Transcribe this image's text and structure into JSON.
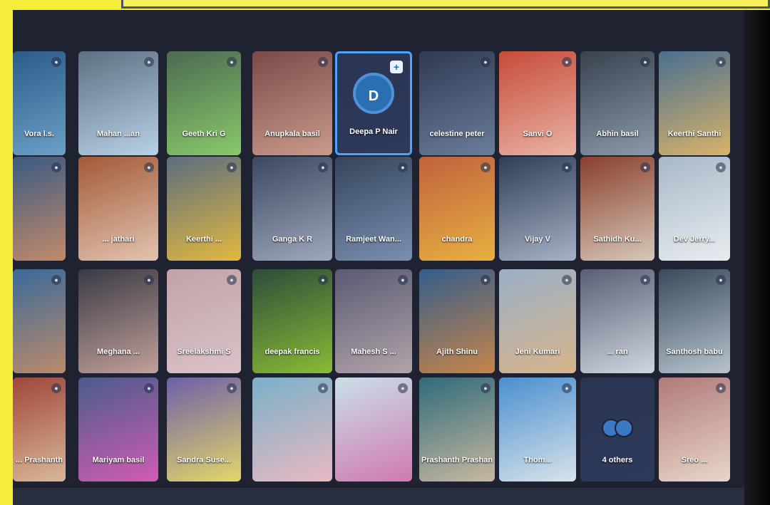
{
  "tiles": [
    {
      "name": "Vora l.s.",
      "bg": [
        "#2c5b88",
        "#6ca0c8"
      ]
    },
    {
      "name": "Mahan ...an",
      "bg": [
        "#5e6f83",
        "#b8d1e7"
      ]
    },
    {
      "name": "Geeth Kri G",
      "bg": [
        "#4c6a52",
        "#89c96a"
      ]
    },
    {
      "name": "Anupkala basil",
      "bg": [
        "#7a4a4a",
        "#c99b8a"
      ]
    },
    {
      "name": "Deepa P Nair",
      "bg": [
        "#2a3552",
        "#2d3a5a"
      ]
    },
    {
      "name": "celestine peter",
      "bg": [
        "#2f3a54",
        "#6b7d99"
      ]
    },
    {
      "name": "Sanvi O",
      "bg": [
        "#c74b3a",
        "#e9b3a4"
      ]
    },
    {
      "name": "Abhin basil",
      "bg": [
        "#39424f",
        "#8a99a9"
      ]
    },
    {
      "name": "Keerthi Santhi",
      "bg": [
        "#4a6f8f",
        "#d8b36a"
      ]
    },
    {
      "name": "",
      "bg": [
        "#3a5a82",
        "#c28a6a"
      ]
    },
    {
      "name": "... jathari",
      "bg": [
        "#a35a38",
        "#e2c4b0"
      ]
    },
    {
      "name": "Keerthi ...",
      "bg": [
        "#5b6d80",
        "#e2b840"
      ]
    },
    {
      "name": "Ganga K R",
      "bg": [
        "#3b4860",
        "#9ea8bd"
      ]
    },
    {
      "name": "Ramjeet Wan...",
      "bg": [
        "#35445b",
        "#7a8fb0"
      ]
    },
    {
      "name": "chandra",
      "bg": [
        "#c0623e",
        "#e8b040"
      ]
    },
    {
      "name": "Vijay V",
      "bg": [
        "#2f3e58",
        "#a6b2c6"
      ]
    },
    {
      "name": "Sathidh Ku...",
      "bg": [
        "#8a3f2e",
        "#d7c8b8"
      ]
    },
    {
      "name": "Dev Jerry...",
      "bg": [
        "#a8b8c8",
        "#e8ecef"
      ]
    },
    {
      "name": "",
      "bg": [
        "#3a6a9a",
        "#bb8a6a"
      ]
    },
    {
      "name": "Meghana ...",
      "bg": [
        "#3a3a45",
        "#c1a09a"
      ]
    },
    {
      "name": "Sreelakshmi S",
      "bg": [
        "#c2a2a8",
        "#d9c3c8"
      ]
    },
    {
      "name": "deepak francis",
      "bg": [
        "#2d4c3a",
        "#8abb35"
      ]
    },
    {
      "name": "Mahesh S ...",
      "bg": [
        "#5a5a73",
        "#b1a3a9"
      ]
    },
    {
      "name": "Ajith Shinu",
      "bg": [
        "#355d8a",
        "#c5854a"
      ]
    },
    {
      "name": "Jeni Kumari",
      "bg": [
        "#9ab0c8",
        "#d7b48a"
      ]
    },
    {
      "name": "... ran",
      "bg": [
        "#5a5e73",
        "#cfd6e0"
      ]
    },
    {
      "name": "Santhosh babu",
      "bg": [
        "#3a4a5a",
        "#b7c4d0"
      ]
    },
    {
      "name": "... Prashanth",
      "bg": [
        "#a0463a",
        "#d9b89a"
      ]
    },
    {
      "name": "Mariyam basil",
      "bg": [
        "#4a5c8a",
        "#d05cb3"
      ]
    },
    {
      "name": "Sandra Suse...",
      "bg": [
        "#6d5fa8",
        "#e3d66a"
      ]
    },
    {
      "name": "",
      "bg": [
        "#7ab0c8",
        "#e8b9c2"
      ]
    },
    {
      "name": "",
      "bg": [
        "#c9dfe8",
        "#d07ab0"
      ]
    },
    {
      "name": "Prashanth Prashan",
      "bg": [
        "#2f6b7a",
        "#c8b8a0"
      ]
    },
    {
      "name": "Thom...",
      "bg": [
        "#4a8fd0",
        "#d8e3ea"
      ]
    },
    {
      "name": "",
      "bg": [
        "#2a3552",
        "#2d3a5a"
      ]
    },
    {
      "name": "Sreo ...",
      "bg": [
        "#b07a7a",
        "#e8d6c8"
      ]
    }
  ],
  "active_tile": {
    "initial": "D",
    "pin_symbol": "+"
  },
  "others_tile": {
    "label": "4 others"
  },
  "colors": {
    "active_border": "#4da3ff",
    "screen_bg": "#1f2230",
    "frame_bg": "#f4ee3a"
  }
}
